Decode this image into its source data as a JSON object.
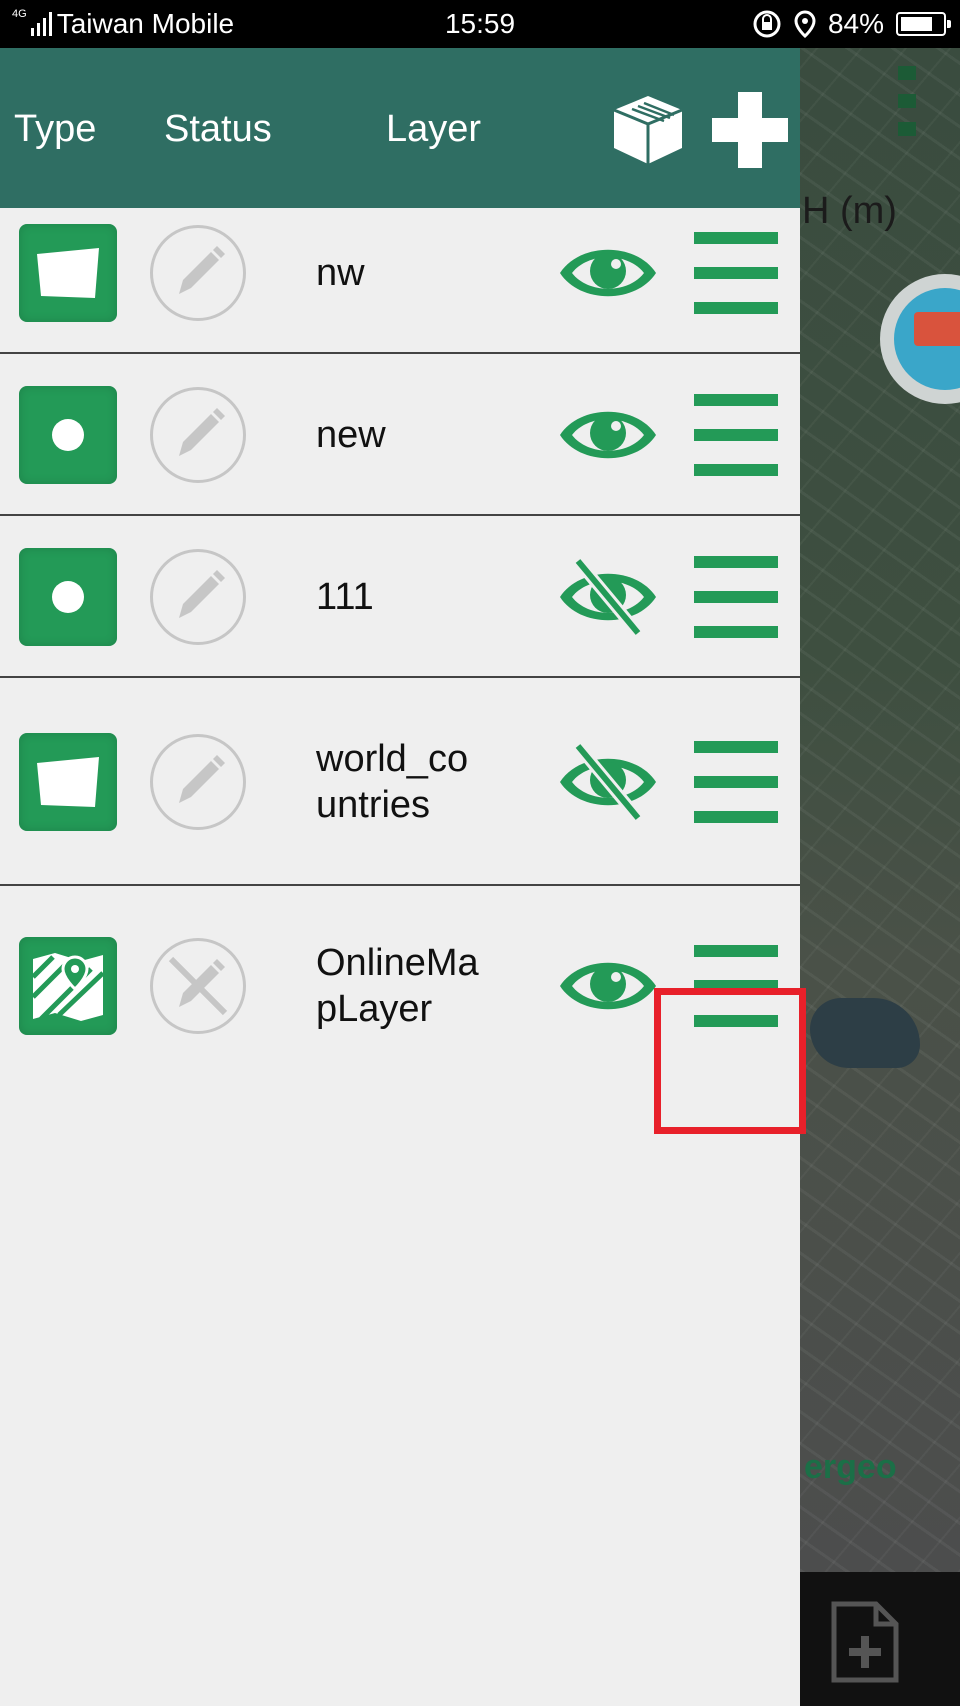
{
  "status_bar": {
    "network": "4G",
    "carrier": "Taiwan Mobile",
    "time": "15:59",
    "battery": "84%",
    "battery_level": 0.84
  },
  "header": {
    "col_type": "Type",
    "col_status": "Status",
    "col_layer": "Layer",
    "box_icon": "package-box-icon",
    "add_icon": "plus-icon"
  },
  "map": {
    "axis_label": "H (m)",
    "brand": "ergeo"
  },
  "layers": [
    {
      "name": "nw",
      "type": "polygon",
      "status": "editable",
      "visible": true
    },
    {
      "name": "new",
      "type": "point",
      "status": "editable",
      "visible": true
    },
    {
      "name": "111",
      "type": "point",
      "status": "editable",
      "visible": false
    },
    {
      "name": "world_co\nuntries",
      "type": "polygon",
      "status": "editable",
      "visible": false
    },
    {
      "name": "OnlineMa\npLayer",
      "type": "online-map",
      "status": "not-editable",
      "visible": true
    }
  ],
  "colors": {
    "header_bg": "#2f6e63",
    "accent_green": "#239a57",
    "highlight_red": "#e8202a",
    "panel_bg": "#efefef"
  }
}
